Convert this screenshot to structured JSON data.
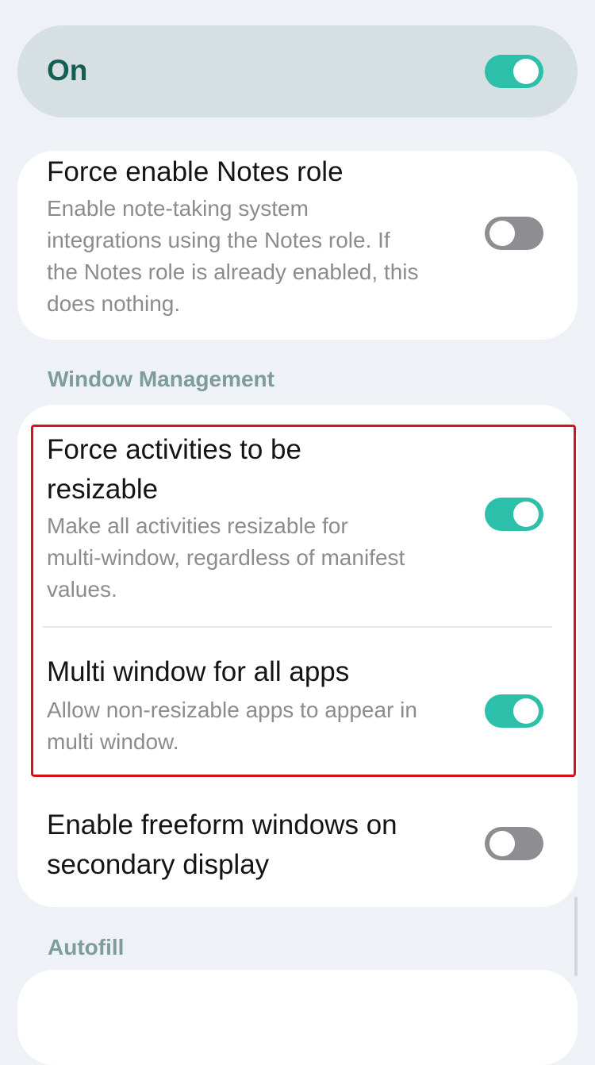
{
  "master": {
    "label": "On",
    "on": true
  },
  "notes_card": {
    "title": "Force enable Notes role",
    "summary_lines": [
      "Enable note-taking system",
      "integrations using the Notes role. If",
      "the Notes role is already enabled, this",
      "does nothing."
    ],
    "on": false
  },
  "window_management": {
    "header": "Window Management",
    "items": [
      {
        "title_lines": [
          "Force activities to be",
          "resizable"
        ],
        "summary_lines": [
          "Make all activities resizable for",
          "multi-window, regardless of manifest",
          "values."
        ],
        "on": true
      },
      {
        "title_lines": [
          "Multi window for all apps"
        ],
        "summary_lines": [
          "Allow non-resizable apps to appear in",
          "multi window."
        ],
        "on": true
      },
      {
        "title_lines": [
          "Enable freeform windows on",
          "secondary display"
        ],
        "on": false
      }
    ]
  },
  "autofill": {
    "header": "Autofill"
  },
  "colors": {
    "accent": "#2cbfa9",
    "switch_off": "#8e8e92",
    "highlight": "#d4141c",
    "background": "#eef2f6"
  }
}
